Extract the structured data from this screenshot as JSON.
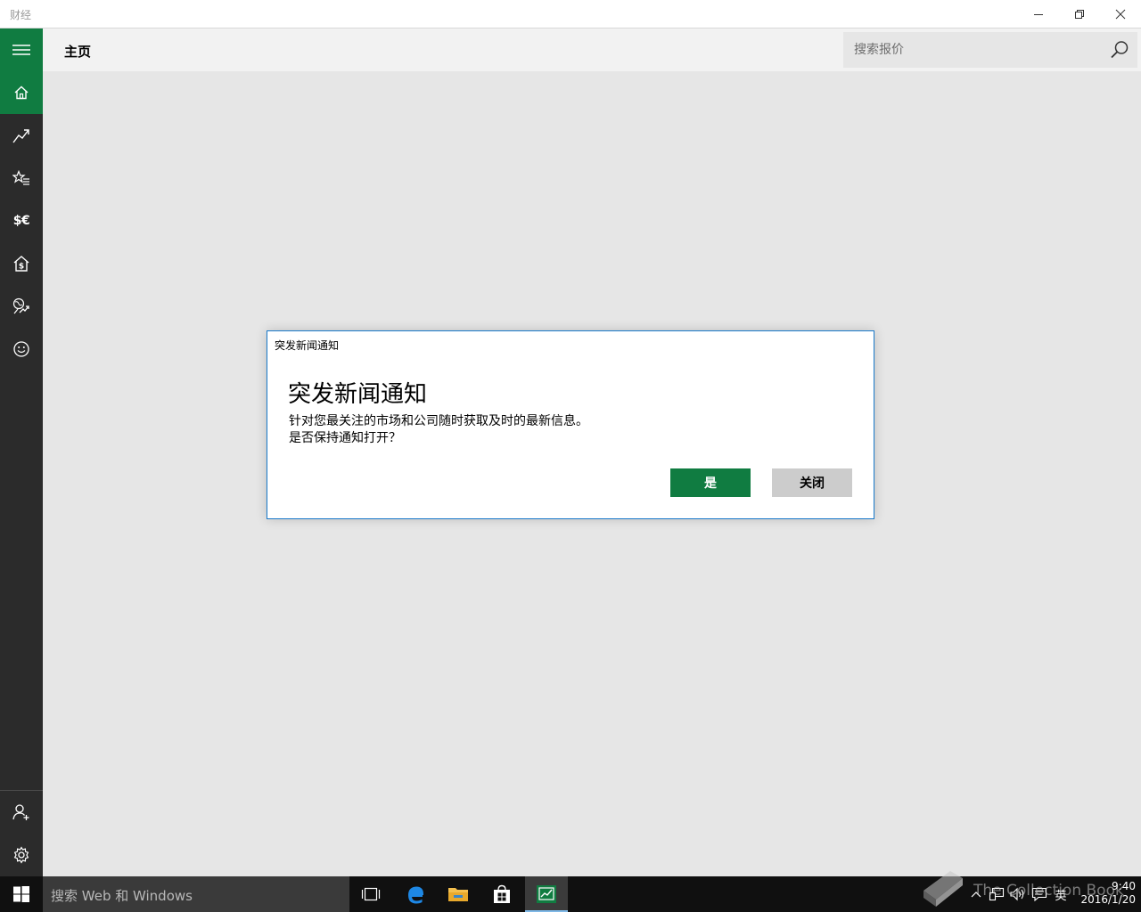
{
  "window": {
    "title": "财经"
  },
  "header": {
    "page_title": "主页",
    "search_placeholder": "搜索报价"
  },
  "sidenav": {
    "items": [
      {
        "icon": "home-icon"
      },
      {
        "icon": "trending-up-icon"
      },
      {
        "icon": "watchlist-star-icon"
      },
      {
        "icon": "currency-icon",
        "label": "$€"
      },
      {
        "icon": "mortgage-house-icon"
      },
      {
        "icon": "markets-globe-icon"
      },
      {
        "icon": "smiley-icon"
      }
    ],
    "bottom": [
      {
        "icon": "account-icon"
      },
      {
        "icon": "settings-icon"
      }
    ]
  },
  "dialog": {
    "caption": "突发新闻通知",
    "heading": "突发新闻通知",
    "body_line1": "针对您最关注的市场和公司随时获取及时的最新信息。",
    "body_line2": "是否保持通知打开？",
    "primary_label": "是",
    "secondary_label": "关闭"
  },
  "taskbar": {
    "search_text": "搜索 Web 和 Windows",
    "time": "9:40",
    "date": "2016/1/20",
    "ime": "英"
  },
  "watermark": {
    "text": "The Collection Book"
  },
  "colors": {
    "accent_green": "#107c41",
    "nav_bg": "#2b2b2b",
    "dialog_border": "#1979ca"
  }
}
